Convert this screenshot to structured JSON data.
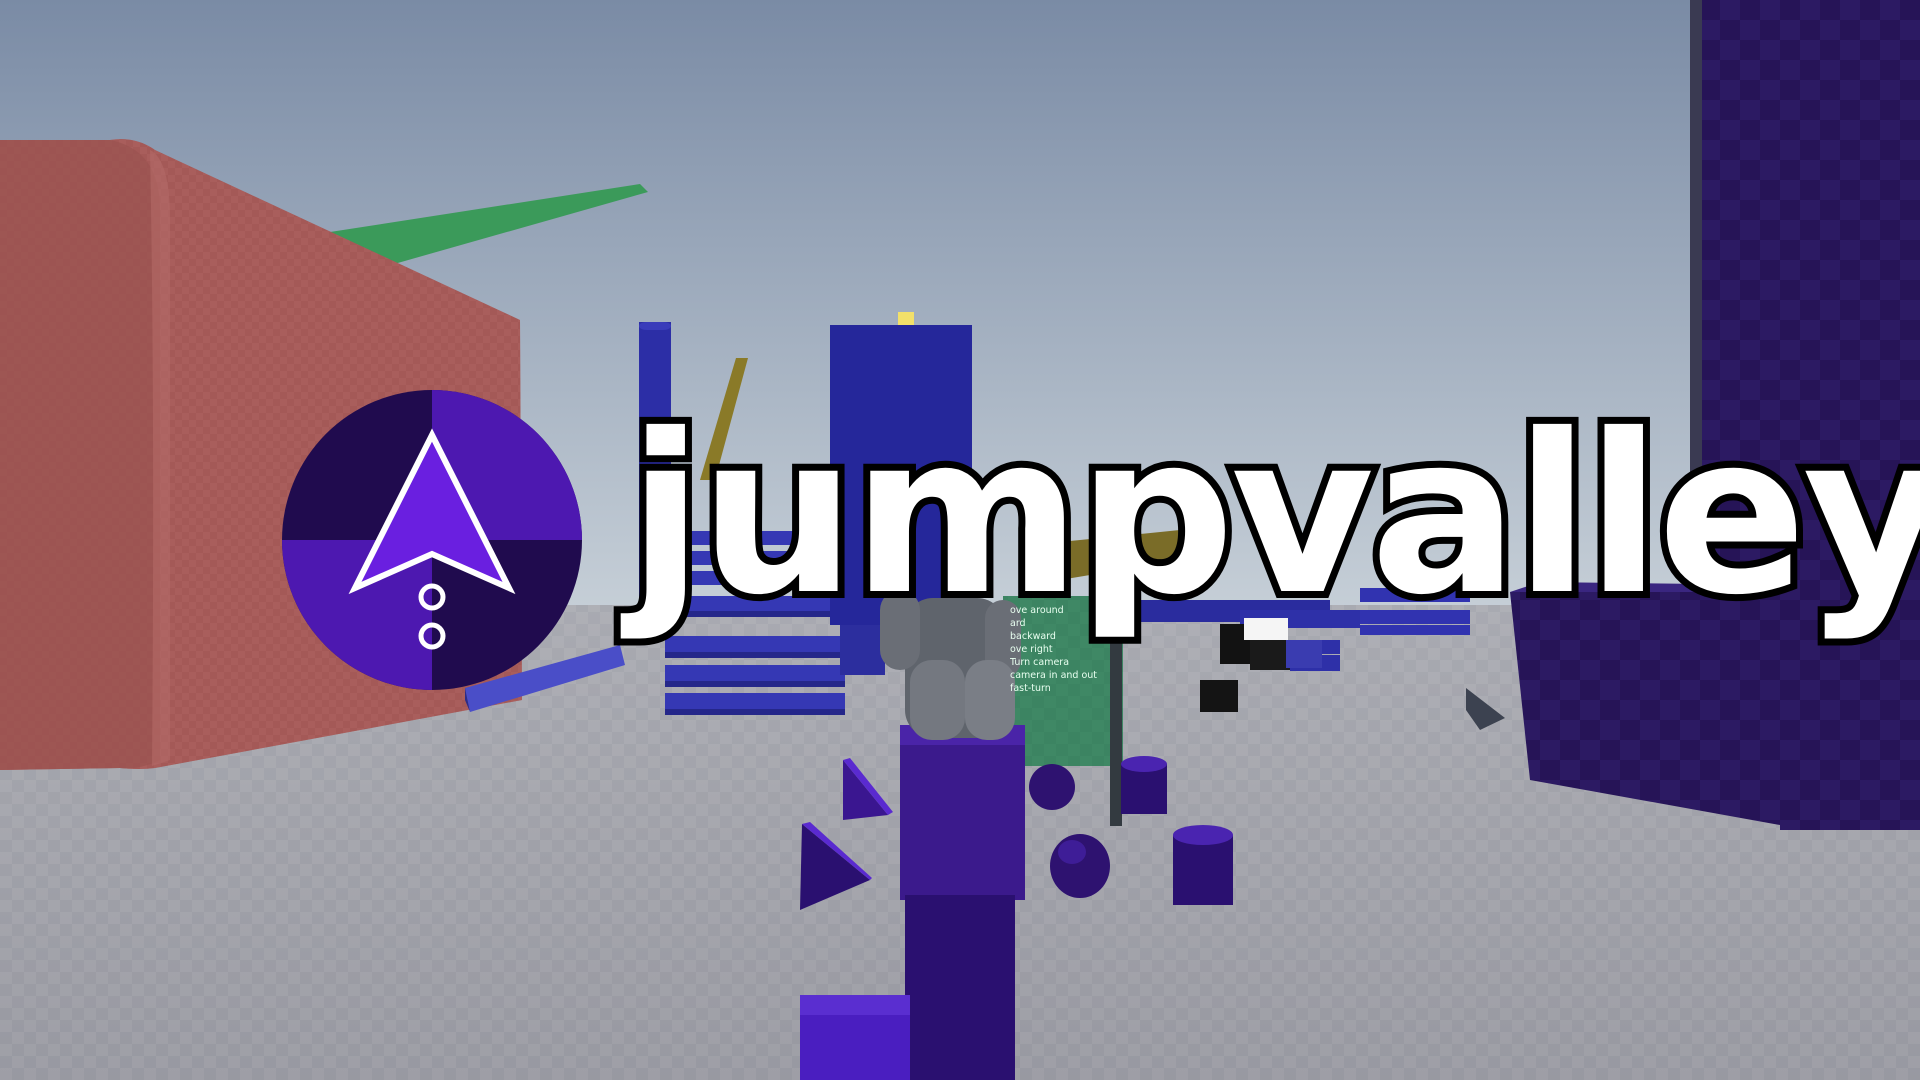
{
  "title": "jumpvalley",
  "logo": {
    "icon": "arrow-up-with-two-rings-icon",
    "colors": {
      "dark": "#200b4e",
      "light": "#4d18b0",
      "arrow": "#6a1fe0",
      "outline": "#ffffff"
    }
  },
  "sign": {
    "lines": [
      "ove around",
      "ard",
      "backward",
      "ove right",
      "Turn camera",
      "camera in and out",
      "fast-turn"
    ]
  },
  "colors": {
    "sky_top": "#7a8ba5",
    "sky_bottom": "#c6cfd7",
    "floor": "#9c9ca4",
    "red_wall": "#a85d5b",
    "green_beam": "#3a9a5a",
    "blue_block": "#25279a",
    "purple_tower": "#26145a",
    "character_body": "#3b1a8c",
    "character_head": "#6a6e76",
    "sign_board": "#1e7e4e"
  }
}
